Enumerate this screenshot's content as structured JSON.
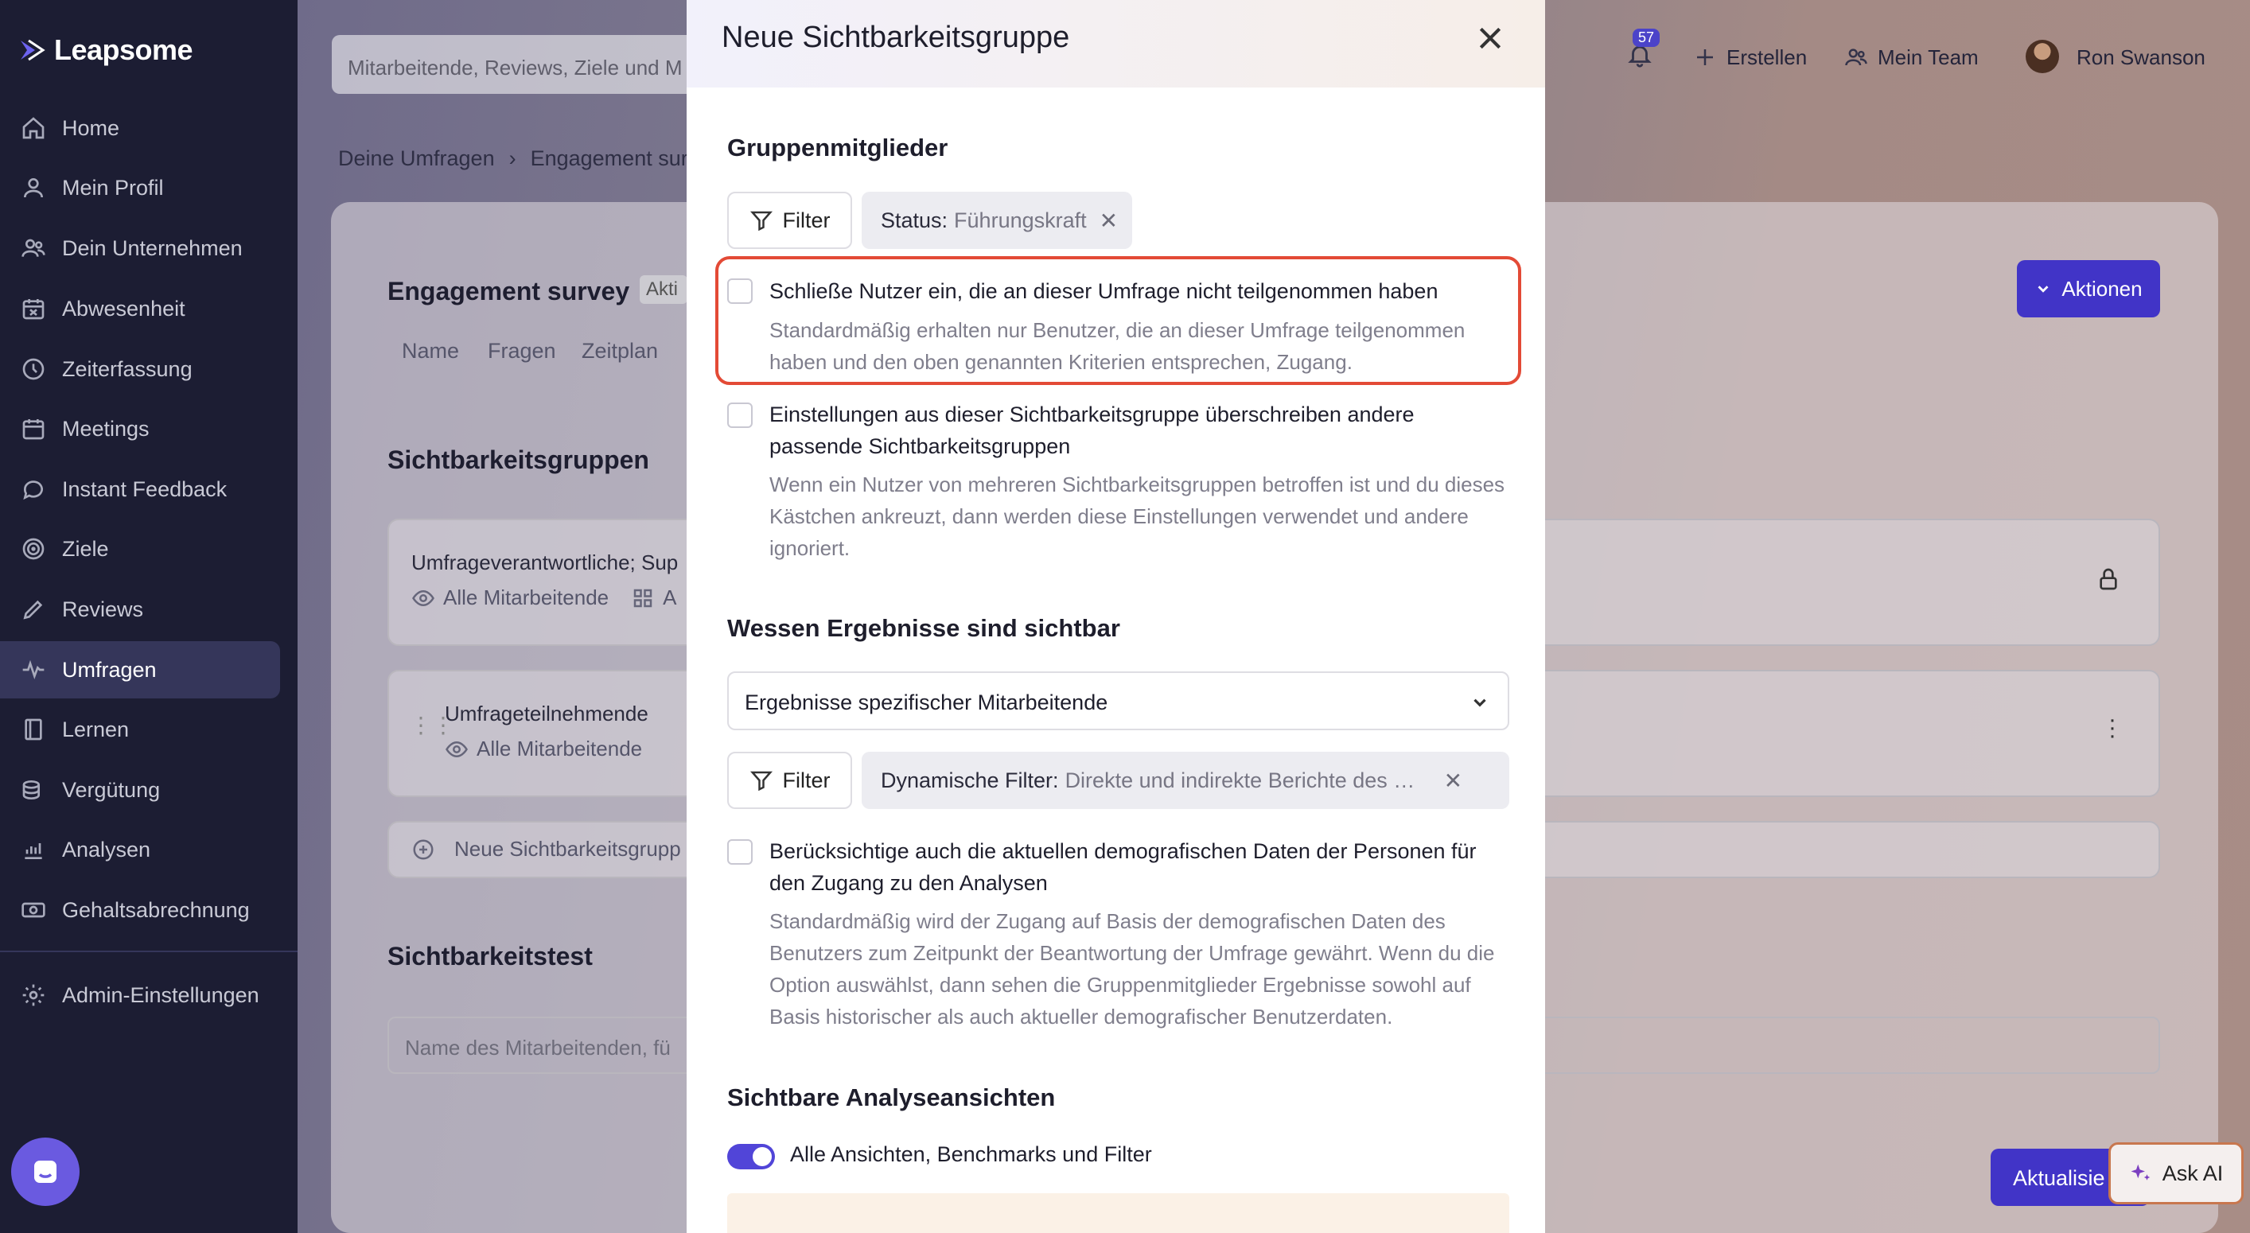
{
  "app": {
    "logo_text": "Leapsome"
  },
  "sidebar": {
    "items": [
      {
        "label": "Home",
        "icon": "home-icon"
      },
      {
        "label": "Mein Profil",
        "icon": "user-icon"
      },
      {
        "label": "Dein Unternehmen",
        "icon": "users-icon"
      },
      {
        "label": "Abwesenheit",
        "icon": "calendar-x-icon"
      },
      {
        "label": "Zeiterfassung",
        "icon": "clock-icon"
      },
      {
        "label": "Meetings",
        "icon": "calendar-icon"
      },
      {
        "label": "Instant Feedback",
        "icon": "chat-icon"
      },
      {
        "label": "Ziele",
        "icon": "target-icon"
      },
      {
        "label": "Reviews",
        "icon": "pencil-icon"
      },
      {
        "label": "Umfragen",
        "icon": "pulse-icon"
      },
      {
        "label": "Lernen",
        "icon": "book-icon"
      },
      {
        "label": "Vergütung",
        "icon": "coins-icon"
      },
      {
        "label": "Analysen",
        "icon": "chart-icon"
      },
      {
        "label": "Gehaltsabrechnung",
        "icon": "banknote-icon"
      }
    ],
    "active_index": 9,
    "admin_label": "Admin-Einstellungen"
  },
  "topbar": {
    "search_placeholder": "Mitarbeitende, Reviews, Ziele und M",
    "notification_count": "57",
    "create_label": "Erstellen",
    "team_label": "Mein Team",
    "user_name": "Ron Swanson"
  },
  "breadcrumb": {
    "root": "Deine Umfragen",
    "separator": "›",
    "current": "Engagement sur"
  },
  "survey": {
    "title": "Engagement survey",
    "status": "Akti",
    "tabs": [
      "Name",
      "Fragen",
      "Zeitplan"
    ],
    "actions_label": "Aktionen",
    "visibility_groups_heading": "Sichtbarkeitsgruppen",
    "groups": [
      {
        "title": "Umfrageverantwortliche; Sup",
        "sub1": "Alle Mitarbeitende",
        "sub2": "A"
      },
      {
        "title": "Umfrageteilnehmende",
        "sub1": "Alle Mitarbeitende",
        "sub2": ""
      }
    ],
    "new_group_label": "Neue Sichtbarkeitsgrupp",
    "test_heading": "Sichtbarkeitstest",
    "test_placeholder": "Name des Mitarbeitenden, fü",
    "update_label": "Aktualisie",
    "ask_ai_label": "Ask AI"
  },
  "modal": {
    "title": "Neue Sichtbarkeitsgruppe",
    "members_heading": "Gruppenmitglieder",
    "filter_label": "Filter",
    "status_chip": {
      "key": "Status:",
      "value": "Führungskraft"
    },
    "option1": {
      "label": "Schließe Nutzer ein, die an dieser Umfrage nicht teilgenommen haben",
      "help": "Standardmäßig erhalten nur Benutzer, die an dieser Umfrage teilgenommen haben und den oben genannten Kriterien entsprechen, Zugang.",
      "checked": false
    },
    "option2": {
      "label": "Einstellungen aus dieser Sichtbarkeitsgruppe überschreiben andere passende Sichtbarkeitsgruppen",
      "help": "Wenn ein Nutzer von mehreren Sichtbarkeitsgruppen betroffen ist und du dieses Kästchen ankreuzt, dann werden diese Einstellungen verwendet und andere ignoriert.",
      "checked": false
    },
    "results_heading": "Wessen Ergebnisse sind sichtbar",
    "results_select": "Ergebnisse spezifischer Mitarbeitende",
    "dynamic_chip": {
      "key": "Dynamische Filter:",
      "value": "Direkte und indirekte Berichte des Grup..."
    },
    "option3": {
      "label": "Berücksichtige auch die aktuellen demografischen Daten der Personen für den Zugang zu den Analysen",
      "help": "Standardmäßig wird der Zugang auf Basis der demografischen Daten des Benutzers zum Zeitpunkt der Beantwortung der Umfrage gewährt. Wenn du die Option auswählst, dann sehen die Gruppenmitglieder Ergebnisse sowohl auf Basis historischer als auch aktueller demografischer Benutzerdaten.",
      "checked": false
    },
    "views_heading": "Sichtbare Analyseansichten",
    "toggle_label": "Alle Ansichten, Benchmarks und Filter",
    "toggle_on": true
  },
  "colors": {
    "accent": "#4134c7",
    "highlight": "#e34a36",
    "sidebar": "#1c1d33"
  }
}
